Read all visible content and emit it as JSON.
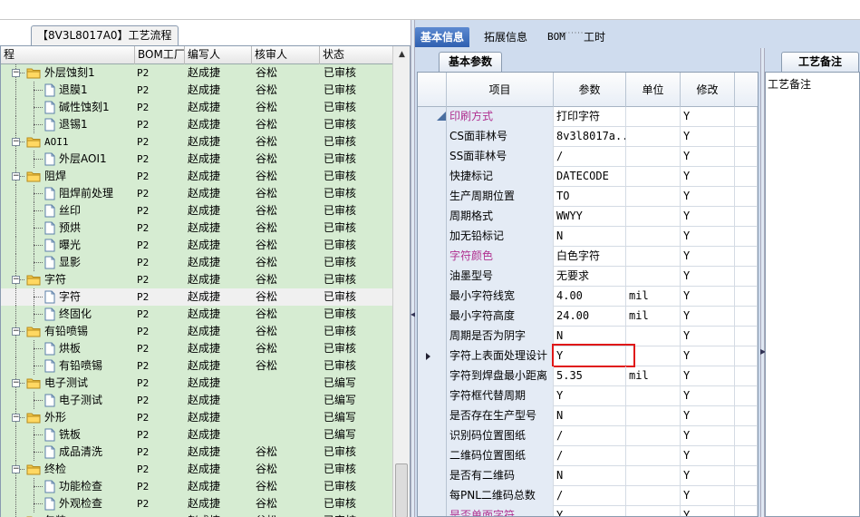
{
  "left_tab_title": "【8V3L8017A0】工艺流程",
  "columns": [
    "程",
    "BOM工厂",
    "编写人",
    "核审人",
    "状态"
  ],
  "tree_rows": [
    {
      "level": 1,
      "type": "folder",
      "name": "外层蚀刻1",
      "bom": "P2",
      "author": "赵成捷",
      "reviewer": "谷松",
      "status": "已审核"
    },
    {
      "level": 2,
      "type": "doc",
      "name": "退膜1",
      "bom": "P2",
      "author": "赵成捷",
      "reviewer": "谷松",
      "status": "已审核"
    },
    {
      "level": 2,
      "type": "doc",
      "name": "碱性蚀刻1",
      "bom": "P2",
      "author": "赵成捷",
      "reviewer": "谷松",
      "status": "已审核"
    },
    {
      "level": 2,
      "type": "doc",
      "name": "退锡1",
      "bom": "P2",
      "author": "赵成捷",
      "reviewer": "谷松",
      "status": "已审核"
    },
    {
      "level": 1,
      "type": "folder",
      "name": "AOI1",
      "bom": "P2",
      "author": "赵成捷",
      "reviewer": "谷松",
      "status": "已审核"
    },
    {
      "level": 2,
      "type": "doc",
      "name": "外层AOI1",
      "bom": "P2",
      "author": "赵成捷",
      "reviewer": "谷松",
      "status": "已审核"
    },
    {
      "level": 1,
      "type": "folder",
      "name": "阻焊",
      "bom": "P2",
      "author": "赵成捷",
      "reviewer": "谷松",
      "status": "已审核"
    },
    {
      "level": 2,
      "type": "doc",
      "name": "阻焊前处理",
      "bom": "P2",
      "author": "赵成捷",
      "reviewer": "谷松",
      "status": "已审核"
    },
    {
      "level": 2,
      "type": "doc",
      "name": "丝印",
      "bom": "P2",
      "author": "赵成捷",
      "reviewer": "谷松",
      "status": "已审核"
    },
    {
      "level": 2,
      "type": "doc",
      "name": "预烘",
      "bom": "P2",
      "author": "赵成捷",
      "reviewer": "谷松",
      "status": "已审核"
    },
    {
      "level": 2,
      "type": "doc",
      "name": "曝光",
      "bom": "P2",
      "author": "赵成捷",
      "reviewer": "谷松",
      "status": "已审核"
    },
    {
      "level": 2,
      "type": "doc",
      "name": "显影",
      "bom": "P2",
      "author": "赵成捷",
      "reviewer": "谷松",
      "status": "已审核"
    },
    {
      "level": 1,
      "type": "folder",
      "name": "字符",
      "bom": "P2",
      "author": "赵成捷",
      "reviewer": "谷松",
      "status": "已审核"
    },
    {
      "level": 2,
      "type": "doc",
      "name": "字符",
      "bom": "P2",
      "author": "赵成捷",
      "reviewer": "谷松",
      "status": "已审核",
      "selected": true
    },
    {
      "level": 2,
      "type": "doc",
      "name": "终固化",
      "bom": "P2",
      "author": "赵成捷",
      "reviewer": "谷松",
      "status": "已审核"
    },
    {
      "level": 1,
      "type": "folder",
      "name": "有铅喷锡",
      "bom": "P2",
      "author": "赵成捷",
      "reviewer": "谷松",
      "status": "已审核"
    },
    {
      "level": 2,
      "type": "doc",
      "name": "烘板",
      "bom": "P2",
      "author": "赵成捷",
      "reviewer": "谷松",
      "status": "已审核"
    },
    {
      "level": 2,
      "type": "doc",
      "name": "有铅喷锡",
      "bom": "P2",
      "author": "赵成捷",
      "reviewer": "谷松",
      "status": "已审核"
    },
    {
      "level": 1,
      "type": "folder",
      "name": "电子测试",
      "bom": "P2",
      "author": "赵成捷",
      "reviewer": "",
      "status": "已编写"
    },
    {
      "level": 2,
      "type": "doc",
      "name": "电子测试",
      "bom": "P2",
      "author": "赵成捷",
      "reviewer": "",
      "status": "已编写"
    },
    {
      "level": 1,
      "type": "folder",
      "name": "外形",
      "bom": "P2",
      "author": "赵成捷",
      "reviewer": "",
      "status": "已编写"
    },
    {
      "level": 2,
      "type": "doc",
      "name": "铣板",
      "bom": "P2",
      "author": "赵成捷",
      "reviewer": "",
      "status": "已编写"
    },
    {
      "level": 2,
      "type": "doc",
      "name": "成品清洗",
      "bom": "P2",
      "author": "赵成捷",
      "reviewer": "谷松",
      "status": "已审核"
    },
    {
      "level": 1,
      "type": "folder",
      "name": "终检",
      "bom": "P2",
      "author": "赵成捷",
      "reviewer": "谷松",
      "status": "已审核"
    },
    {
      "level": 2,
      "type": "doc",
      "name": "功能检查",
      "bom": "P2",
      "author": "赵成捷",
      "reviewer": "谷松",
      "status": "已审核"
    },
    {
      "level": 2,
      "type": "doc",
      "name": "外观检查",
      "bom": "P2",
      "author": "赵成捷",
      "reviewer": "谷松",
      "status": "已审核"
    },
    {
      "level": 1,
      "type": "folder",
      "name": "包装",
      "bom": "P2",
      "author": "赵成捷",
      "reviewer": "谷松",
      "status": "已审核"
    }
  ],
  "main_tabs": [
    "基本信息",
    "拓展信息",
    "BOM",
    "工时"
  ],
  "active_tab": 0,
  "sub_tab": "基本参数",
  "param_headers": [
    "项目",
    "参数",
    "单位",
    "修改"
  ],
  "params": [
    {
      "name": "印刷方式",
      "value": "打印字符",
      "unit": "",
      "modify": "Y",
      "highlight": true
    },
    {
      "name": "CS面菲林号",
      "value": "8v3l8017a...",
      "unit": "",
      "modify": "Y"
    },
    {
      "name": "SS面菲林号",
      "value": "/",
      "unit": "",
      "modify": "Y"
    },
    {
      "name": "快捷标记",
      "value": "DATECODE",
      "unit": "",
      "modify": "Y"
    },
    {
      "name": "生产周期位置",
      "value": "TO",
      "unit": "",
      "modify": "Y"
    },
    {
      "name": "周期格式",
      "value": "WWYY",
      "unit": "",
      "modify": "Y"
    },
    {
      "name": "加无铅标记",
      "value": "N",
      "unit": "",
      "modify": "Y"
    },
    {
      "name": "字符颜色",
      "value": "白色字符",
      "unit": "",
      "modify": "Y",
      "highlight": true
    },
    {
      "name": "油墨型号",
      "value": "无要求",
      "unit": "",
      "modify": "Y"
    },
    {
      "name": "最小字符线宽",
      "value": "4.00",
      "unit": "mil",
      "modify": "Y"
    },
    {
      "name": "最小字符高度",
      "value": "24.00",
      "unit": "mil",
      "modify": "Y"
    },
    {
      "name": "周期是否为阴字",
      "value": "N",
      "unit": "",
      "modify": "Y"
    },
    {
      "name": "字符上表面处理设计",
      "value": "Y",
      "unit": "",
      "modify": "Y",
      "current": true
    },
    {
      "name": "字符到焊盘最小距离",
      "value": "5.35",
      "unit": "mil",
      "modify": "Y"
    },
    {
      "name": "字符框代替周期",
      "value": "Y",
      "unit": "",
      "modify": "Y"
    },
    {
      "name": "是否存在生产型号",
      "value": "N",
      "unit": "",
      "modify": "Y"
    },
    {
      "name": "识别码位置图纸",
      "value": "/",
      "unit": "",
      "modify": "Y"
    },
    {
      "name": "二维码位置图纸",
      "value": "/",
      "unit": "",
      "modify": "Y"
    },
    {
      "name": "是否有二维码",
      "value": "N",
      "unit": "",
      "modify": "Y"
    },
    {
      "name": "每PNL二维码总数",
      "value": "/",
      "unit": "",
      "modify": "Y"
    },
    {
      "name": "是否单面字符",
      "value": "Y",
      "unit": "",
      "modify": "Y",
      "highlight": true
    }
  ],
  "notes_tab": "工艺备注",
  "notes_label": "工艺备注",
  "colors": {
    "tree_bg": "#d6ecd2",
    "tab_active": "#2f5fb0",
    "highlight_text": "#b03090",
    "panel_bg": "#cfdcee",
    "red_box": "#e01818"
  }
}
